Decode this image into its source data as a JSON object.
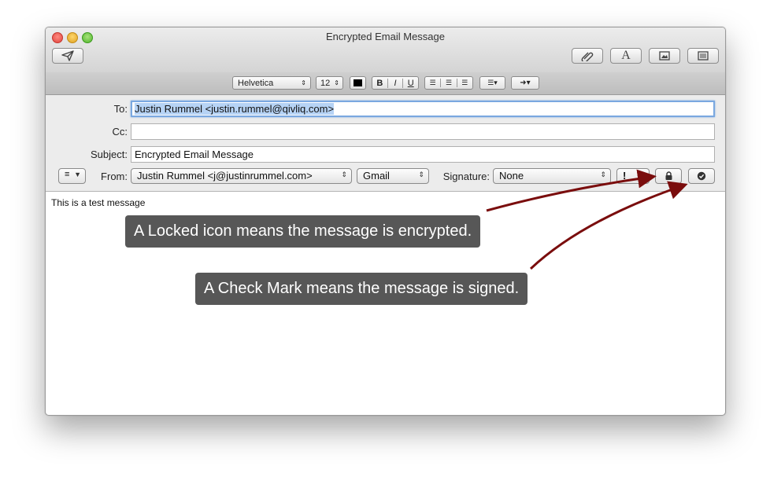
{
  "window": {
    "title": "Encrypted Email Message"
  },
  "toolbar": {
    "send_icon": "paper-plane-icon",
    "attach_icon": "paperclip-icon",
    "fonts_icon": "letter-a-icon",
    "photo_icon": "photo-browser-icon",
    "template_icon": "stationery-icon"
  },
  "format_bar": {
    "font": "Helvetica",
    "size": "12",
    "color": "#000000",
    "bold": "B",
    "italic": "I",
    "underline": "U"
  },
  "header": {
    "to_label": "To:",
    "to_value": "Justin Rummel <justin.rummel@qivliq.com>",
    "cc_label": "Cc:",
    "cc_value": "",
    "subject_label": "Subject:",
    "subject_value": "Encrypted Email Message",
    "from_label": "From:",
    "from_value": "Justin Rummel <j@justinrummel.com>",
    "account_value": "Gmail",
    "signature_label": "Signature:",
    "signature_value": "None",
    "priority_label": "!",
    "header_menu_icon": "list-icon"
  },
  "message": {
    "body": "This is a test message"
  },
  "callouts": {
    "encrypted": "A Locked icon means the message is encrypted.",
    "signed": "A Check Mark means the message is signed."
  },
  "colors": {
    "arrow": "#7a0d0d",
    "callout_bg": "#575757",
    "selection": "#b6d3f5"
  }
}
